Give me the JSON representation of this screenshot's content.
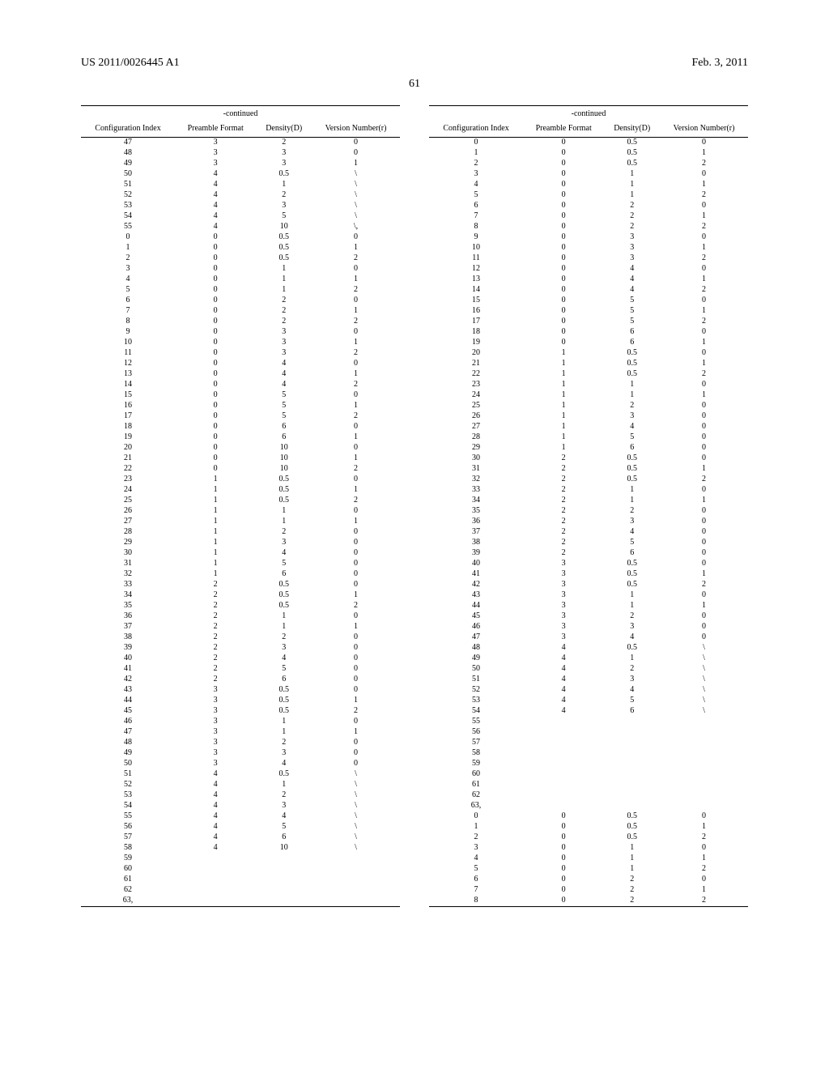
{
  "header": {
    "left": "US 2011/0026445 A1",
    "right": "Feb. 3, 2011"
  },
  "page_number": "61",
  "tables": {
    "continued_label": "-continued",
    "columns": [
      "Configuration Index",
      "Preamble Format",
      "Density(D)",
      "Version Number(r)"
    ]
  },
  "left_rows": [
    [
      "47",
      "3",
      "2",
      "0"
    ],
    [
      "48",
      "3",
      "3",
      "0"
    ],
    [
      "49",
      "3",
      "3",
      "1"
    ],
    [
      "50",
      "4",
      "0.5",
      "\\"
    ],
    [
      "51",
      "4",
      "1",
      "\\"
    ],
    [
      "52",
      "4",
      "2",
      "\\"
    ],
    [
      "53",
      "4",
      "3",
      "\\"
    ],
    [
      "54",
      "4",
      "5",
      "\\"
    ],
    [
      "55",
      "4",
      "10",
      "\\,"
    ],
    [
      "0",
      "0",
      "0.5",
      "0"
    ],
    [
      "1",
      "0",
      "0.5",
      "1"
    ],
    [
      "2",
      "0",
      "0.5",
      "2"
    ],
    [
      "3",
      "0",
      "1",
      "0"
    ],
    [
      "4",
      "0",
      "1",
      "1"
    ],
    [
      "5",
      "0",
      "1",
      "2"
    ],
    [
      "6",
      "0",
      "2",
      "0"
    ],
    [
      "7",
      "0",
      "2",
      "1"
    ],
    [
      "8",
      "0",
      "2",
      "2"
    ],
    [
      "9",
      "0",
      "3",
      "0"
    ],
    [
      "10",
      "0",
      "3",
      "1"
    ],
    [
      "11",
      "0",
      "3",
      "2"
    ],
    [
      "12",
      "0",
      "4",
      "0"
    ],
    [
      "13",
      "0",
      "4",
      "1"
    ],
    [
      "14",
      "0",
      "4",
      "2"
    ],
    [
      "15",
      "0",
      "5",
      "0"
    ],
    [
      "16",
      "0",
      "5",
      "1"
    ],
    [
      "17",
      "0",
      "5",
      "2"
    ],
    [
      "18",
      "0",
      "6",
      "0"
    ],
    [
      "19",
      "0",
      "6",
      "1"
    ],
    [
      "20",
      "0",
      "10",
      "0"
    ],
    [
      "21",
      "0",
      "10",
      "1"
    ],
    [
      "22",
      "0",
      "10",
      "2"
    ],
    [
      "23",
      "1",
      "0.5",
      "0"
    ],
    [
      "24",
      "1",
      "0.5",
      "1"
    ],
    [
      "25",
      "1",
      "0.5",
      "2"
    ],
    [
      "26",
      "1",
      "1",
      "0"
    ],
    [
      "27",
      "1",
      "1",
      "1"
    ],
    [
      "28",
      "1",
      "2",
      "0"
    ],
    [
      "29",
      "1",
      "3",
      "0"
    ],
    [
      "30",
      "1",
      "4",
      "0"
    ],
    [
      "31",
      "1",
      "5",
      "0"
    ],
    [
      "32",
      "1",
      "6",
      "0"
    ],
    [
      "33",
      "2",
      "0.5",
      "0"
    ],
    [
      "34",
      "2",
      "0.5",
      "1"
    ],
    [
      "35",
      "2",
      "0.5",
      "2"
    ],
    [
      "36",
      "2",
      "1",
      "0"
    ],
    [
      "37",
      "2",
      "1",
      "1"
    ],
    [
      "38",
      "2",
      "2",
      "0"
    ],
    [
      "39",
      "2",
      "3",
      "0"
    ],
    [
      "40",
      "2",
      "4",
      "0"
    ],
    [
      "41",
      "2",
      "5",
      "0"
    ],
    [
      "42",
      "2",
      "6",
      "0"
    ],
    [
      "43",
      "3",
      "0.5",
      "0"
    ],
    [
      "44",
      "3",
      "0.5",
      "1"
    ],
    [
      "45",
      "3",
      "0.5",
      "2"
    ],
    [
      "46",
      "3",
      "1",
      "0"
    ],
    [
      "47",
      "3",
      "1",
      "1"
    ],
    [
      "48",
      "3",
      "2",
      "0"
    ],
    [
      "49",
      "3",
      "3",
      "0"
    ],
    [
      "50",
      "3",
      "4",
      "0"
    ],
    [
      "51",
      "4",
      "0.5",
      "\\"
    ],
    [
      "52",
      "4",
      "1",
      "\\"
    ],
    [
      "53",
      "4",
      "2",
      "\\"
    ],
    [
      "54",
      "4",
      "3",
      "\\"
    ],
    [
      "55",
      "4",
      "4",
      "\\"
    ],
    [
      "56",
      "4",
      "5",
      "\\"
    ],
    [
      "57",
      "4",
      "6",
      "\\"
    ],
    [
      "58",
      "4",
      "10",
      "\\"
    ],
    [
      "59",
      "",
      "",
      ""
    ],
    [
      "60",
      "",
      "",
      ""
    ],
    [
      "61",
      "",
      "",
      ""
    ],
    [
      "62",
      "",
      "",
      ""
    ],
    [
      "63,",
      "",
      "",
      ""
    ]
  ],
  "right_rows": [
    [
      "0",
      "0",
      "0.5",
      "0"
    ],
    [
      "1",
      "0",
      "0.5",
      "1"
    ],
    [
      "2",
      "0",
      "0.5",
      "2"
    ],
    [
      "3",
      "0",
      "1",
      "0"
    ],
    [
      "4",
      "0",
      "1",
      "1"
    ],
    [
      "5",
      "0",
      "1",
      "2"
    ],
    [
      "6",
      "0",
      "2",
      "0"
    ],
    [
      "7",
      "0",
      "2",
      "1"
    ],
    [
      "8",
      "0",
      "2",
      "2"
    ],
    [
      "9",
      "0",
      "3",
      "0"
    ],
    [
      "10",
      "0",
      "3",
      "1"
    ],
    [
      "11",
      "0",
      "3",
      "2"
    ],
    [
      "12",
      "0",
      "4",
      "0"
    ],
    [
      "13",
      "0",
      "4",
      "1"
    ],
    [
      "14",
      "0",
      "4",
      "2"
    ],
    [
      "15",
      "0",
      "5",
      "0"
    ],
    [
      "16",
      "0",
      "5",
      "1"
    ],
    [
      "17",
      "0",
      "5",
      "2"
    ],
    [
      "18",
      "0",
      "6",
      "0"
    ],
    [
      "19",
      "0",
      "6",
      "1"
    ],
    [
      "20",
      "1",
      "0.5",
      "0"
    ],
    [
      "21",
      "1",
      "0.5",
      "1"
    ],
    [
      "22",
      "1",
      "0.5",
      "2"
    ],
    [
      "23",
      "1",
      "1",
      "0"
    ],
    [
      "24",
      "1",
      "1",
      "1"
    ],
    [
      "25",
      "1",
      "2",
      "0"
    ],
    [
      "26",
      "1",
      "3",
      "0"
    ],
    [
      "27",
      "1",
      "4",
      "0"
    ],
    [
      "28",
      "1",
      "5",
      "0"
    ],
    [
      "29",
      "1",
      "6",
      "0"
    ],
    [
      "30",
      "2",
      "0.5",
      "0"
    ],
    [
      "31",
      "2",
      "0.5",
      "1"
    ],
    [
      "32",
      "2",
      "0.5",
      "2"
    ],
    [
      "33",
      "2",
      "1",
      "0"
    ],
    [
      "34",
      "2",
      "1",
      "1"
    ],
    [
      "35",
      "2",
      "2",
      "0"
    ],
    [
      "36",
      "2",
      "3",
      "0"
    ],
    [
      "37",
      "2",
      "4",
      "0"
    ],
    [
      "38",
      "2",
      "5",
      "0"
    ],
    [
      "39",
      "2",
      "6",
      "0"
    ],
    [
      "40",
      "3",
      "0.5",
      "0"
    ],
    [
      "41",
      "3",
      "0.5",
      "1"
    ],
    [
      "42",
      "3",
      "0.5",
      "2"
    ],
    [
      "43",
      "3",
      "1",
      "0"
    ],
    [
      "44",
      "3",
      "1",
      "1"
    ],
    [
      "45",
      "3",
      "2",
      "0"
    ],
    [
      "46",
      "3",
      "3",
      "0"
    ],
    [
      "47",
      "3",
      "4",
      "0"
    ],
    [
      "48",
      "4",
      "0.5",
      "\\"
    ],
    [
      "49",
      "4",
      "1",
      "\\"
    ],
    [
      "50",
      "4",
      "2",
      "\\"
    ],
    [
      "51",
      "4",
      "3",
      "\\"
    ],
    [
      "52",
      "4",
      "4",
      "\\"
    ],
    [
      "53",
      "4",
      "5",
      "\\"
    ],
    [
      "54",
      "4",
      "6",
      "\\"
    ],
    [
      "55",
      "",
      "",
      ""
    ],
    [
      "56",
      "",
      "",
      ""
    ],
    [
      "57",
      "",
      "",
      ""
    ],
    [
      "58",
      "",
      "",
      ""
    ],
    [
      "59",
      "",
      "",
      ""
    ],
    [
      "60",
      "",
      "",
      ""
    ],
    [
      "61",
      "",
      "",
      ""
    ],
    [
      "62",
      "",
      "",
      ""
    ],
    [
      "63,",
      "",
      "",
      ""
    ],
    [
      "0",
      "0",
      "0.5",
      "0"
    ],
    [
      "1",
      "0",
      "0.5",
      "1"
    ],
    [
      "2",
      "0",
      "0.5",
      "2"
    ],
    [
      "3",
      "0",
      "1",
      "0"
    ],
    [
      "4",
      "0",
      "1",
      "1"
    ],
    [
      "5",
      "0",
      "1",
      "2"
    ],
    [
      "6",
      "0",
      "2",
      "0"
    ],
    [
      "7",
      "0",
      "2",
      "1"
    ],
    [
      "8",
      "0",
      "2",
      "2"
    ]
  ]
}
